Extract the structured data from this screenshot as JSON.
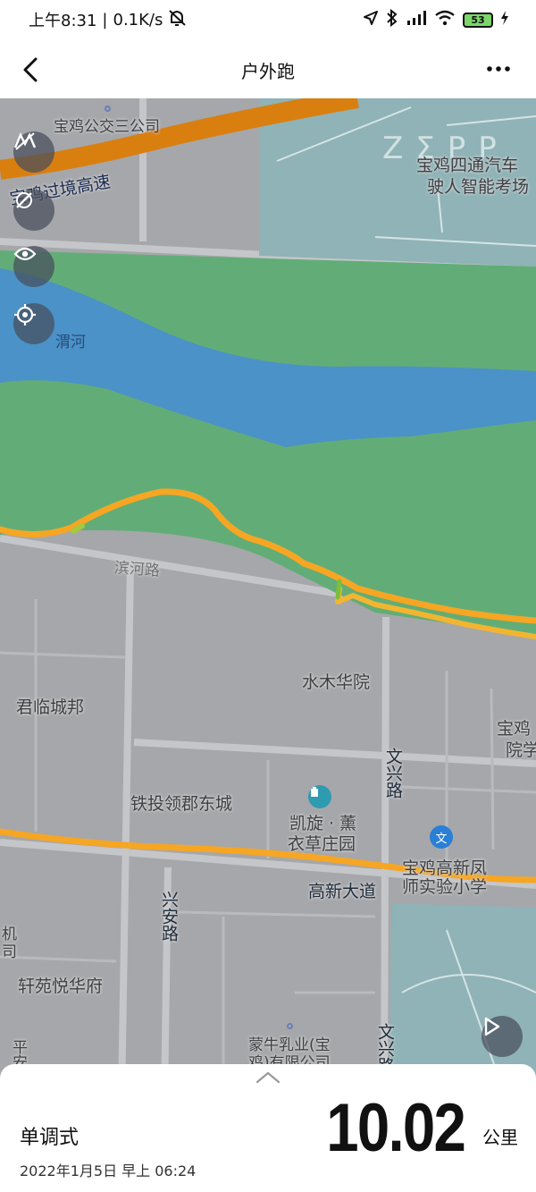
{
  "status_bar": {
    "time": "上午8:31",
    "speed": "0.1K/s",
    "battery": "53"
  },
  "nav": {
    "title": "户外跑",
    "back_icon": "chevron-left-icon",
    "more_icon": "more-horizontal-icon"
  },
  "map": {
    "watermark": "ZΣPP",
    "colors": {
      "river": "#4a92c8",
      "park": "#62ad77",
      "water_block": "#8fb3b7",
      "route": "#f6a623",
      "highway": "#d97f10"
    },
    "labels": {
      "bus_company": "宝鸡公交三公司",
      "highway": "宝鸡过境高速",
      "driving_school_1": "宝鸡四通汽车",
      "driving_school_2": "驶人智能考场",
      "river": "渭河",
      "binhe_road": "滨河路",
      "shuimu": "水木华院",
      "junlin": "君临城邦",
      "school_right_1": "宝鸡",
      "school_right_2": "院学",
      "wenxing_road": "文兴路",
      "tietou": "铁投领郡东城",
      "kaixuan_1": "凯旋 · 薰",
      "kaixuan_2": "衣草庄园",
      "primary_school_1": "宝鸡高新凤",
      "primary_school_2": "师实验小学",
      "gaoxin_road": "高新大道",
      "xingan_road": "兴安路",
      "left_company_1": "机",
      "left_company_2": "司",
      "xuanyuan": "轩苑悦华府",
      "mengniu_1": "蒙牛乳业(宝",
      "mengniu_2": "鸡)有限公司",
      "wenxing_road_2": "文兴路",
      "left_bottom": "平安"
    },
    "controls": {
      "layer_icon": "map-layer-icon",
      "hide_icon": "eye-off-icon",
      "eye_icon": "eye-icon",
      "locate_icon": "locate-icon",
      "play_icon": "play-icon"
    }
  },
  "summary": {
    "workout_name": "单调式",
    "date": "2022年1月5日 早上 06:24",
    "distance": "10.02",
    "unit": "公里"
  }
}
